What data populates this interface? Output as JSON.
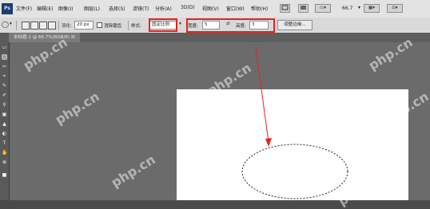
{
  "app": {
    "logo": "Ps"
  },
  "menu": [
    {
      "label": "文件(F)"
    },
    {
      "label": "编辑(E)"
    },
    {
      "label": "图像(I)"
    },
    {
      "label": "图层(L)"
    },
    {
      "label": "选择(S)"
    },
    {
      "label": "滤镜(T)"
    },
    {
      "label": "分析(A)"
    },
    {
      "label": "3D(D)"
    },
    {
      "label": "视图(V)"
    },
    {
      "label": "窗口(W)"
    },
    {
      "label": "帮助(H)"
    }
  ],
  "menubar_right": {
    "zoom_value": "66.7",
    "zoom_arrow": "▾"
  },
  "options": {
    "feather_label": "羽化:",
    "feather_value": "20 px",
    "antialias_label": "消除锯齿",
    "style_label": "样式:",
    "style_value": "固定比例",
    "width_label": "宽度:",
    "width_value": "5",
    "swap_symbol": "⇄",
    "height_label": "高度:",
    "height_value": "3",
    "refine_edge": "调整边缘..."
  },
  "document": {
    "tab_label": "未标题-1 @ 66.7%(RGB/8) ☒"
  },
  "watermarks": [
    "php.cn",
    "php.cn",
    "php.cn",
    "php.cn",
    "php.cn",
    "php.cn",
    "php.cn"
  ],
  "toolbox": [
    {
      "glyph": "▭"
    },
    {
      "glyph": "◯"
    },
    {
      "glyph": "✂"
    },
    {
      "glyph": "⌖"
    },
    {
      "glyph": "✎"
    },
    {
      "glyph": "✐"
    },
    {
      "glyph": "⚲"
    },
    {
      "glyph": "▣"
    },
    {
      "glyph": "▲"
    },
    {
      "glyph": "◐"
    },
    {
      "glyph": "T"
    },
    {
      "glyph": "✋"
    },
    {
      "glyph": "⊕"
    },
    {
      "glyph": "■"
    }
  ],
  "colors": {
    "highlight": "#e52222",
    "canvas_bg": "#6b6b6b",
    "document_bg": "#ffffff"
  }
}
